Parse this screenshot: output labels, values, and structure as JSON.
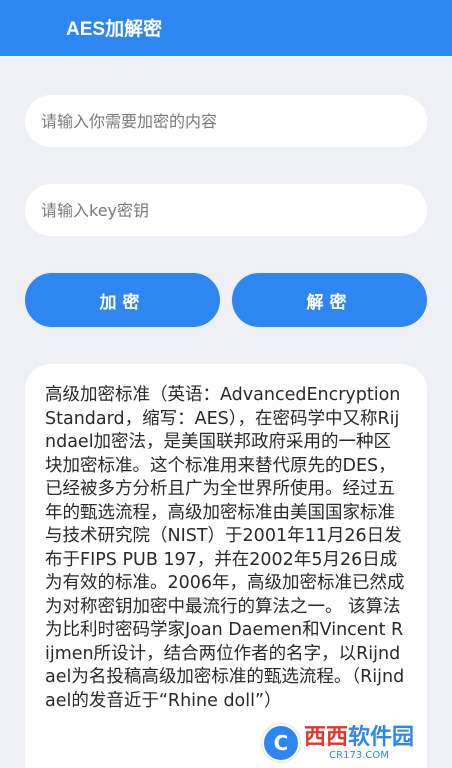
{
  "appbar": {
    "title": "AES加解密"
  },
  "inputs": {
    "content_placeholder": "请输入你需要加密的内容",
    "key_placeholder": "请输入key密钥"
  },
  "buttons": {
    "encrypt": "加密",
    "decrypt": "解密"
  },
  "result": {
    "text": "高级加密标准（英语：AdvancedEncryptionStandard，缩写：AES），在密码学中又称Rijndael加密法，是美国联邦政府采用的一种区块加密标准。这个标准用来替代原先的DES，已经被多方分析且广为全世界所使用。经过五年的甄选流程，高级加密标准由美国国家标准与技术研究院（NIST）于2001年11月26日发布于FIPS PUB 197，并在2002年5月26日成为有效的标准。2006年，高级加密标准已然成为对称密钥加密中最流行的算法之一。 该算法为比利时密码学家Joan Daemen和Vincent Rijmen所设计，结合两位作者的名字，以Rijndael为名投稿高级加密标准的甄选流程。（Rijndael的发音近于“Rhine doll”）"
  },
  "watermark": {
    "brand_red": "西西",
    "brand_blue": "软件园",
    "url": "CR173.COM"
  },
  "colors": {
    "accent": "#2d86f2",
    "background": "#eef0f5"
  }
}
